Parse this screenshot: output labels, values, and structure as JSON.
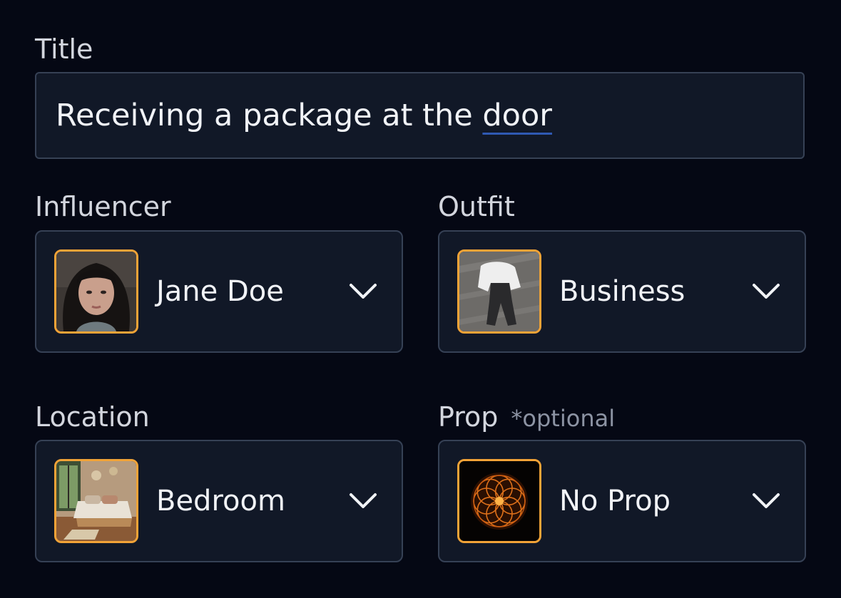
{
  "title_field": {
    "label": "Title",
    "value_main": "Receiving a package at the ",
    "value_flagged": "door"
  },
  "influencer": {
    "label": "Influencer",
    "value": "Jane Doe",
    "thumbnail": "portrait-photo"
  },
  "outfit": {
    "label": "Outfit",
    "value": "Business",
    "thumbnail": "outfit-photo"
  },
  "location": {
    "label": "Location",
    "value": "Bedroom",
    "thumbnail": "bedroom-photo"
  },
  "prop": {
    "label": "Prop",
    "optional_note": "*optional",
    "value": "No Prop",
    "thumbnail": "mandala-image"
  },
  "colors": {
    "background": "#050814",
    "field": "#111827",
    "border": "#364155",
    "thumb_border": "#f2a337",
    "spellcheck_underline": "#2f59b3"
  },
  "icons": {
    "dropdown": "chevron-down-icon"
  }
}
